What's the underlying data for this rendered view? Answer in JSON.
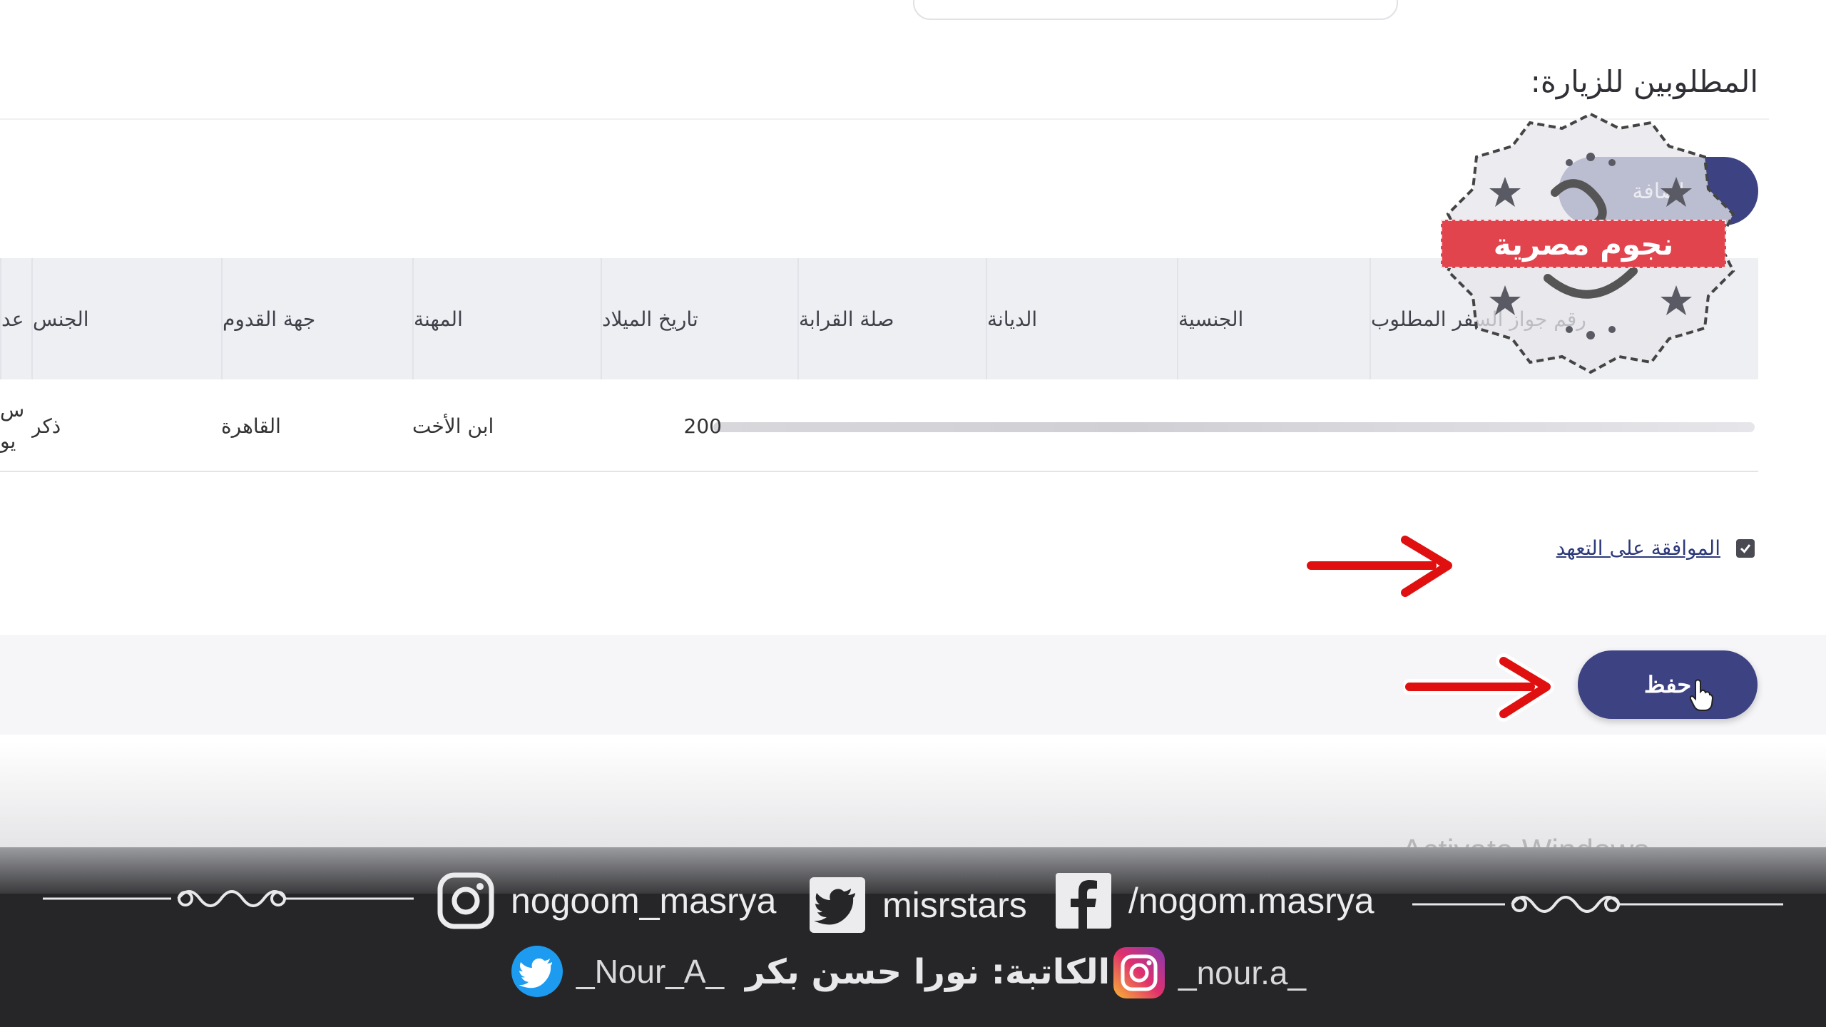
{
  "section": {
    "title": "المطلوبين للزيارة:",
    "add_label": "إضافة"
  },
  "table": {
    "headers": [
      "رقم جواز السفر المطلوب",
      "الجنسية",
      "الديانة",
      "صلة القرابة",
      "تاريخ الميلاد",
      "المهنة",
      "جهة القدوم",
      "الجنس",
      "عد"
    ],
    "row": {
      "birth_date": "200",
      "relation": "ابن الأخت",
      "origin": "القاهرة",
      "gender": "ذكر",
      "partial_line1": "س",
      "partial_line2": "يو"
    }
  },
  "agreement": {
    "label": "الموافقة على التعهد",
    "checked": true
  },
  "save_label": "حفظ",
  "os_watermark": "Activate Windows",
  "watermark_logo_text": "نجوم مصرية",
  "social": {
    "instagram": "nogoom_masrya",
    "twitter": "misrstars",
    "facebook": "/nogom.masrya",
    "author_twitter": "_Nour_A_",
    "author_label": "الكاتبة: نورا حسن بكر",
    "author_instagram": "_nour.a_"
  },
  "colors": {
    "primary_button": "#3d4382",
    "arrow_red": "#e01010",
    "banner_red": "#e2444e",
    "footer_bg": "#262628"
  },
  "icons": [
    "instagram-icon",
    "twitter-icon",
    "facebook-icon",
    "check-icon",
    "arrow-right-icon",
    "cursor-icon"
  ]
}
